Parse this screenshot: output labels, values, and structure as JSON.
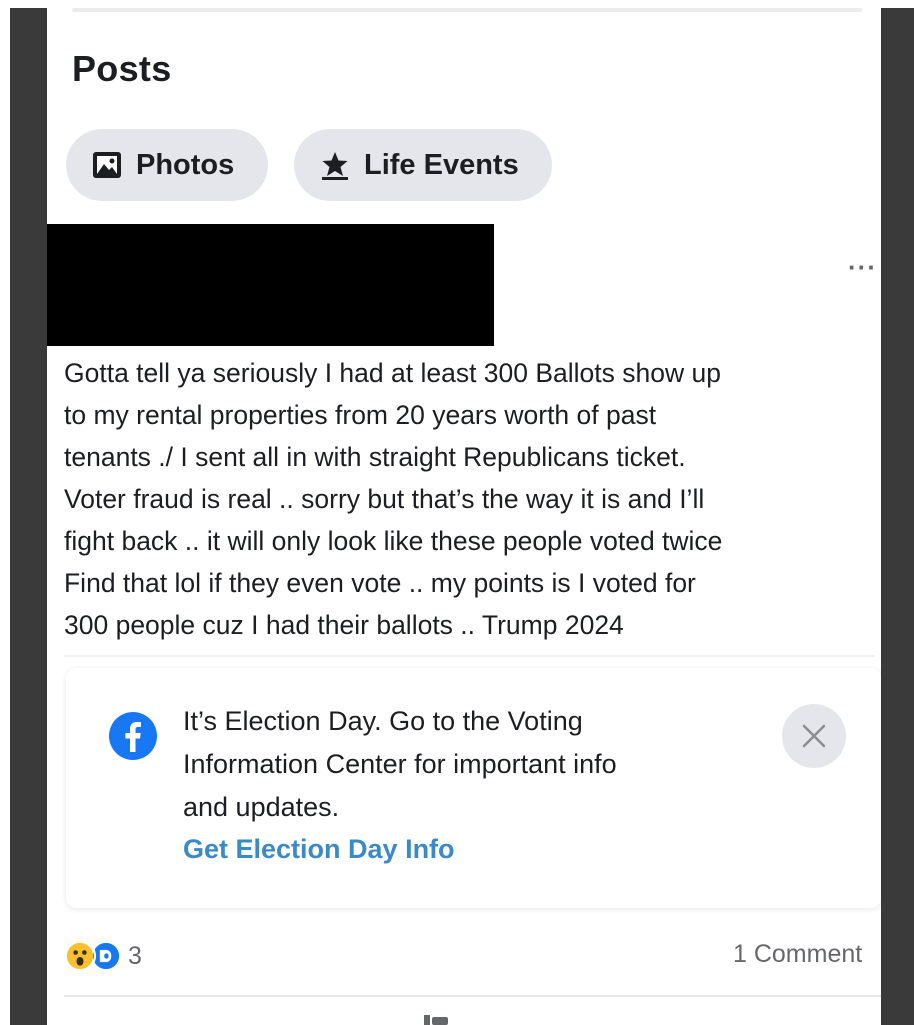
{
  "section": {
    "title": "Posts"
  },
  "filters": [
    {
      "label": "Photos",
      "icon": "photos-icon"
    },
    {
      "label": "Life Events",
      "icon": "star-flag-icon"
    }
  ],
  "post": {
    "author": "",
    "more_label": "···",
    "lines": [
      "Gotta tell ya seriously I had at least 300 Ballots show up",
      "to my rental properties from 20 years worth of past",
      "tenants ./ I sent all in with straight Republicans ticket.",
      "Voter fraud is real .. sorry but that’s the way it is and I’ll",
      "fight back .. it will only look like these people voted twice",
      "Find that lol if they even vote .. my points is I voted for",
      "300 people cuz I had their ballots .. Trump 2024"
    ]
  },
  "election_notice": {
    "lines": [
      "It’s Election Day. Go to the Voting",
      "Information Center for important info",
      "and updates."
    ],
    "link_label": "Get Election Day Info",
    "icon": "facebook-logo-icon",
    "brand_color": "#1877f2",
    "link_color": "#3b89c9"
  },
  "footer": {
    "reaction_icons": [
      "wow-reaction-icon",
      "care-reaction-icon"
    ],
    "reaction_count": "3",
    "comments_label": "1 Comment"
  }
}
